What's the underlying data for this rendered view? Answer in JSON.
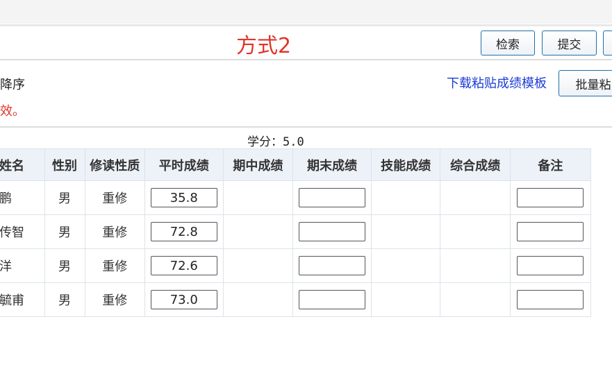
{
  "header": {
    "mode_title": "方式2",
    "search_label": "检索",
    "submit_label": "提交"
  },
  "toolbar": {
    "sort_text": "降序",
    "notice_text": "效。",
    "template_link": "下载粘贴成绩模板",
    "batch_label": "批量粘"
  },
  "credit_label": "学分：5.0",
  "table": {
    "headers": [
      "姓名",
      "性别",
      "修读性质",
      "平时成绩",
      "期中成绩",
      "期末成绩",
      "技能成绩",
      "综合成绩",
      "备注"
    ],
    "rows": [
      {
        "name": "鹏",
        "gender": "男",
        "type": "重修",
        "usual": "35.8"
      },
      {
        "name": "传智",
        "gender": "男",
        "type": "重修",
        "usual": "72.8"
      },
      {
        "name": "洋",
        "gender": "男",
        "type": "重修",
        "usual": "72.6"
      },
      {
        "name": "毓甫",
        "gender": "男",
        "type": "重修",
        "usual": "73.0"
      }
    ]
  }
}
